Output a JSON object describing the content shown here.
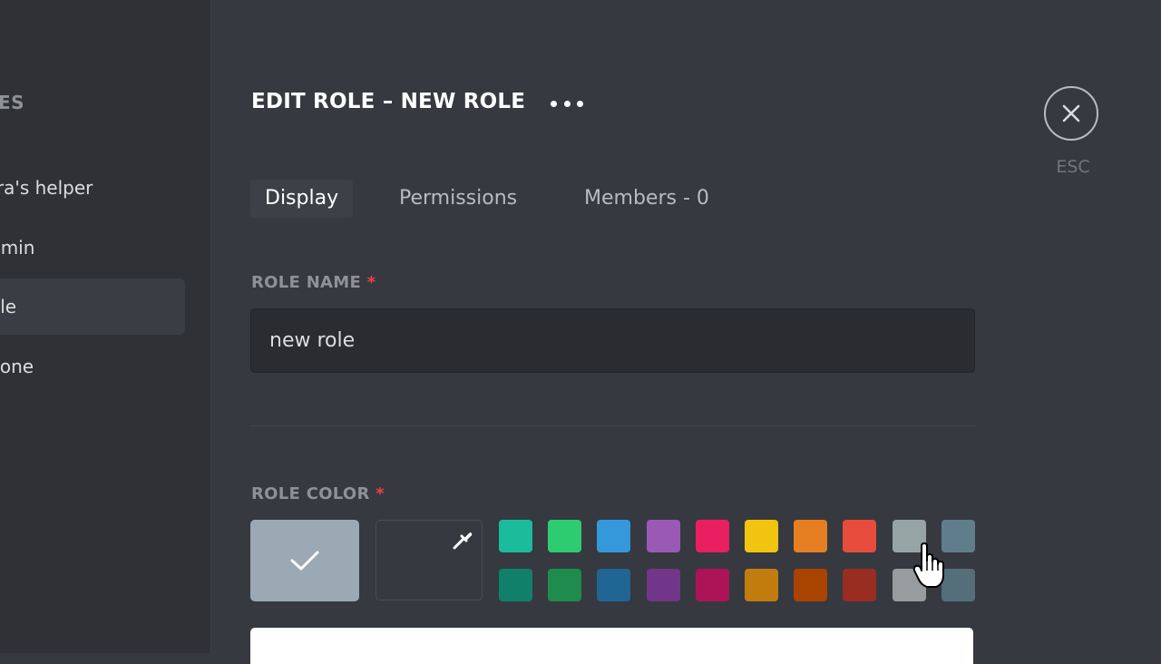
{
  "sidebar": {
    "header": "ES",
    "roles": [
      {
        "label": "tra's helper"
      },
      {
        "label": "dmin"
      },
      {
        "label": "ole"
      },
      {
        "label": "yone"
      }
    ]
  },
  "header": {
    "title": "EDIT ROLE – NEW ROLE",
    "more_icon": "more-horizontal-icon",
    "close_icon": "close-icon",
    "esc_label": "ESC"
  },
  "tabs": [
    {
      "label": "Display",
      "active": true
    },
    {
      "label": "Permissions",
      "active": false
    },
    {
      "label": "Members - 0",
      "active": false
    }
  ],
  "role_name": {
    "label": "ROLE NAME",
    "required_mark": "*",
    "value": "new role"
  },
  "role_color": {
    "label": "ROLE COLOR",
    "required_mark": "*",
    "selected_color": "#9aa9b3",
    "check_icon": "check-icon",
    "picker_icon": "eyedropper-icon",
    "swatches_top": [
      "#1abc9c",
      "#2ecc71",
      "#3498db",
      "#9b59b6",
      "#e91e63",
      "#f1c40f",
      "#e67e22",
      "#e74c3c",
      "#95a5a6",
      "#607d8b"
    ],
    "swatches_bottom": [
      "#11806a",
      "#1f8b4c",
      "#206694",
      "#71368a",
      "#ad1457",
      "#c27c0e",
      "#a84300",
      "#992d22",
      "#979c9f",
      "#546e7a"
    ]
  },
  "colors": {
    "background": "#36393f",
    "sidebar": "#2f3136",
    "required": "#ed4245"
  }
}
